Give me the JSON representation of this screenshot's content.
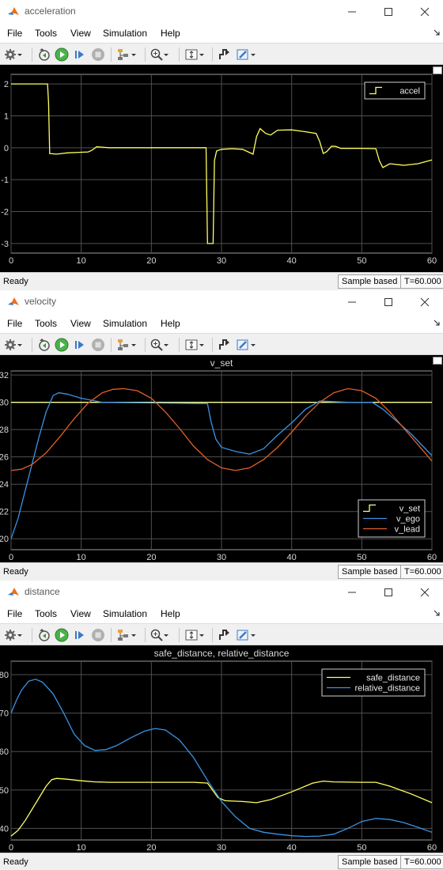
{
  "menu": [
    "File",
    "Tools",
    "View",
    "Simulation",
    "Help"
  ],
  "windows": [
    {
      "title": "acceleration",
      "status": {
        "state": "Ready",
        "mode": "Sample based",
        "time": "T=60.000"
      },
      "chart_data": {
        "type": "line",
        "title": "",
        "xlim": [
          0,
          60
        ],
        "ylim": [
          -3.3,
          2.3
        ],
        "xticks": [
          0,
          10,
          20,
          30,
          40,
          50,
          60
        ],
        "yticks": [
          -3,
          -2,
          -1,
          0,
          1,
          2
        ],
        "grid": true,
        "legend_position": "top-right",
        "series": [
          {
            "name": "accel",
            "color": "#ffff5f",
            "points": [
              [
                0,
                2
              ],
              [
                5.2,
                2
              ],
              [
                5.35,
                1.4
              ],
              [
                5.5,
                -0.18
              ],
              [
                6.5,
                -0.2
              ],
              [
                8,
                -0.16
              ],
              [
                10,
                -0.14
              ],
              [
                11,
                -0.13
              ],
              [
                11.5,
                -0.08
              ],
              [
                12.2,
                0.03
              ],
              [
                12.8,
                0.02
              ],
              [
                14,
                0
              ],
              [
                20,
                0
              ],
              [
                27.8,
                0
              ],
              [
                28,
                -3
              ],
              [
                28.8,
                -3
              ],
              [
                29,
                -0.4
              ],
              [
                29.3,
                -0.1
              ],
              [
                30,
                -0.05
              ],
              [
                31.5,
                -0.03
              ],
              [
                33,
                -0.05
              ],
              [
                34.5,
                -0.2
              ],
              [
                35,
                0.35
              ],
              [
                35.5,
                0.6
              ],
              [
                36.3,
                0.45
              ],
              [
                37,
                0.4
              ],
              [
                38,
                0.55
              ],
              [
                40,
                0.56
              ],
              [
                42,
                0.5
              ],
              [
                43.5,
                0.45
              ],
              [
                44,
                0.2
              ],
              [
                44.5,
                -0.18
              ],
              [
                45,
                -0.12
              ],
              [
                45.7,
                0.05
              ],
              [
                46.3,
                0.04
              ],
              [
                47,
                -0.02
              ],
              [
                50,
                -0.02
              ],
              [
                52,
                -0.03
              ],
              [
                52.5,
                -0.4
              ],
              [
                53,
                -0.62
              ],
              [
                54,
                -0.5
              ],
              [
                56,
                -0.55
              ],
              [
                58,
                -0.5
              ],
              [
                60,
                -0.38
              ]
            ]
          }
        ]
      }
    },
    {
      "title": "velocity",
      "status": {
        "state": "Ready",
        "mode": "Sample based",
        "time": "T=60.000"
      },
      "chart_data": {
        "type": "line",
        "title": "v_set",
        "xlim": [
          0,
          60
        ],
        "ylim": [
          19.2,
          32.3
        ],
        "xticks": [
          0,
          10,
          20,
          30,
          40,
          50,
          60
        ],
        "yticks": [
          20,
          22,
          24,
          26,
          28,
          30,
          32
        ],
        "grid": true,
        "legend_position": "bottom-right",
        "series": [
          {
            "name": "v_set",
            "color": "#ffff8c",
            "points": [
              [
                0,
                30
              ],
              [
                60,
                30
              ]
            ]
          },
          {
            "name": "v_ego",
            "color": "#3a93e6",
            "points": [
              [
                0,
                20
              ],
              [
                1,
                21.5
              ],
              [
                2,
                23.5
              ],
              [
                3,
                25.5
              ],
              [
                4,
                27.5
              ],
              [
                5,
                29.3
              ],
              [
                6,
                30.5
              ],
              [
                6.8,
                30.7
              ],
              [
                8,
                30.6
              ],
              [
                10,
                30.3
              ],
              [
                12,
                30.1
              ],
              [
                13,
                30
              ],
              [
                20,
                29.95
              ],
              [
                28,
                29.9
              ],
              [
                28.5,
                28.6
              ],
              [
                29.2,
                27.3
              ],
              [
                30,
                26.7
              ],
              [
                32,
                26.4
              ],
              [
                34,
                26.2
              ],
              [
                36,
                26.6
              ],
              [
                38,
                27.6
              ],
              [
                40,
                28.5
              ],
              [
                42,
                29.5
              ],
              [
                44,
                30.1
              ],
              [
                46,
                30.05
              ],
              [
                48,
                30
              ],
              [
                50,
                30
              ],
              [
                51.5,
                30
              ],
              [
                53,
                29.5
              ],
              [
                55,
                28.6
              ],
              [
                57,
                27.7
              ],
              [
                60,
                26.1
              ]
            ]
          },
          {
            "name": "v_lead",
            "color": "#e0602a",
            "points": [
              [
                0,
                25
              ],
              [
                1.5,
                25.1
              ],
              [
                3,
                25.45
              ],
              [
                5,
                26.3
              ],
              [
                7,
                27.5
              ],
              [
                9,
                28.8
              ],
              [
                11,
                29.95
              ],
              [
                13,
                30.7
              ],
              [
                14.5,
                30.95
              ],
              [
                16,
                31
              ],
              [
                18,
                30.85
              ],
              [
                20,
                30.3
              ],
              [
                22,
                29.3
              ],
              [
                24,
                28.1
              ],
              [
                26,
                26.8
              ],
              [
                28,
                25.8
              ],
              [
                30,
                25.2
              ],
              [
                32,
                25
              ],
              [
                34,
                25.2
              ],
              [
                36,
                25.8
              ],
              [
                38,
                26.7
              ],
              [
                40,
                27.8
              ],
              [
                42,
                29
              ],
              [
                44,
                30
              ],
              [
                46,
                30.7
              ],
              [
                48,
                31
              ],
              [
                50,
                30.85
              ],
              [
                52,
                30.3
              ],
              [
                54,
                29.3
              ],
              [
                56,
                28.1
              ],
              [
                58,
                26.9
              ],
              [
                60,
                25.7
              ]
            ]
          }
        ]
      }
    },
    {
      "title": "distance",
      "status": {
        "state": "Ready",
        "mode": "Sample based",
        "time": "T=60.000"
      },
      "chart_data": {
        "type": "line",
        "title": "safe_distance, relative_distance",
        "xlim": [
          0,
          60
        ],
        "ylim": [
          37,
          83.5
        ],
        "xticks": [
          0,
          10,
          20,
          30,
          40,
          50,
          60
        ],
        "yticks": [
          40,
          50,
          60,
          70,
          80
        ],
        "grid": true,
        "legend_position": "top-right",
        "series": [
          {
            "name": "safe_distance",
            "color": "#ffff5f",
            "points": [
              [
                0,
                38
              ],
              [
                1,
                39.5
              ],
              [
                2,
                42
              ],
              [
                3,
                45
              ],
              [
                4,
                48
              ],
              [
                5,
                51
              ],
              [
                5.8,
                52.7
              ],
              [
                6.5,
                53
              ],
              [
                8,
                52.8
              ],
              [
                10,
                52.4
              ],
              [
                12,
                52.1
              ],
              [
                14,
                52
              ],
              [
                20,
                52
              ],
              [
                26,
                52
              ],
              [
                28,
                51.8
              ],
              [
                29.5,
                48
              ],
              [
                30.5,
                47.2
              ],
              [
                33,
                47
              ],
              [
                35,
                46.7
              ],
              [
                37,
                47.5
              ],
              [
                40,
                49.5
              ],
              [
                43,
                51.8
              ],
              [
                44.5,
                52.3
              ],
              [
                46,
                52.1
              ],
              [
                50,
                52
              ],
              [
                52,
                52
              ],
              [
                54,
                51
              ],
              [
                57,
                49
              ],
              [
                60,
                46.7
              ]
            ]
          },
          {
            "name": "relative_distance",
            "color": "#3a93e6",
            "points": [
              [
                0,
                70
              ],
              [
                0.8,
                73.5
              ],
              [
                1.5,
                76
              ],
              [
                2.5,
                78.3
              ],
              [
                3.5,
                78.8
              ],
              [
                4.5,
                78
              ],
              [
                6,
                75
              ],
              [
                7.5,
                70
              ],
              [
                9,
                64.5
              ],
              [
                10.5,
                61.5
              ],
              [
                12,
                60.3
              ],
              [
                13.5,
                60.5
              ],
              [
                15,
                61.5
              ],
              [
                17,
                63.5
              ],
              [
                19,
                65.3
              ],
              [
                20.5,
                66
              ],
              [
                22,
                65.6
              ],
              [
                24,
                63
              ],
              [
                26,
                58.5
              ],
              [
                28,
                52.5
              ],
              [
                30,
                47
              ],
              [
                32,
                43
              ],
              [
                34,
                40
              ],
              [
                36,
                39
              ],
              [
                38,
                38.5
              ],
              [
                40,
                38.1
              ],
              [
                42,
                37.9
              ],
              [
                44,
                38
              ],
              [
                46,
                38.5
              ],
              [
                48,
                40
              ],
              [
                50,
                41.8
              ],
              [
                52,
                42.6
              ],
              [
                54,
                42.3
              ],
              [
                56,
                41.5
              ],
              [
                58,
                40.3
              ],
              [
                60,
                39
              ]
            ]
          }
        ]
      }
    }
  ]
}
